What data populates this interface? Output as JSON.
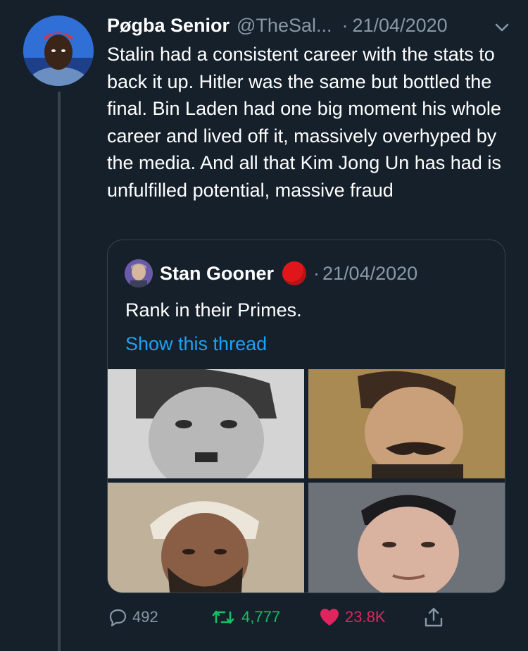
{
  "tweet": {
    "name": "Pøgba Senior",
    "handle": "@TheSal...",
    "separator": "·",
    "date": "21/04/2020",
    "text": "Stalin had a consistent career with the stats to back it up. Hitler was the same but bottled the final. Bin Laden had one big moment his whole career and lived off it, massively overhyped by the media. And all that Kim Jong Un has had is unfulfilled potential, massive fraud"
  },
  "quote": {
    "name": "Stan Gooner",
    "separator": "·",
    "date": "21/04/2020",
    "text": "Rank in their Primes.",
    "link": "Show this thread"
  },
  "actions": {
    "replies": "492",
    "retweets": "4,777",
    "likes": "23.8K"
  },
  "colors": {
    "background": "#15202b",
    "secondary_text": "#8899a6",
    "link": "#1da1f2",
    "retweet_active": "#17bf63",
    "like_active": "#e0245e",
    "border": "#38444d"
  },
  "icons": [
    "caret-down-icon",
    "red-circle-emoji",
    "reply-icon",
    "retweet-icon",
    "heart-icon",
    "share-icon"
  ]
}
